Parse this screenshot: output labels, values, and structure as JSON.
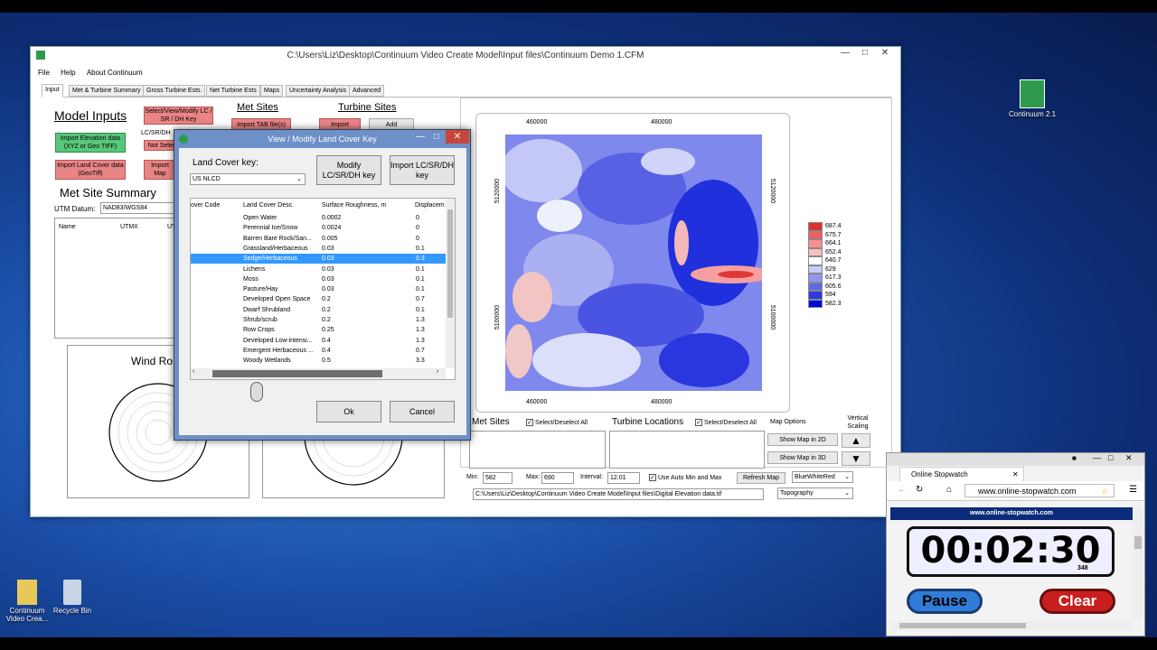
{
  "desktop": {
    "icons": [
      {
        "label": "Continuum 2.1"
      },
      {
        "label": "Continuum Video Crea..."
      },
      {
        "label": "Recycle Bin"
      }
    ]
  },
  "window": {
    "title": "C:\\Users\\Liz\\Desktop\\Continuum Video Create Model\\Input files\\Continuum Demo 1.CFM",
    "menu": [
      "File",
      "Help",
      "About Continuum"
    ],
    "tabs": [
      "Input",
      "Met & Turbine Summary",
      "Gross Turbine Ests.",
      "Net Turbine Ests",
      "Maps",
      "Uncertainty Analysis",
      "Advanced"
    ],
    "model_inputs_heading": "Model Inputs",
    "btn_select_lc": "Select/View/Modify LC / SR / DH Key",
    "lc_label": "LC/SR/DH",
    "not_selected": "Not Selec",
    "btn_import_elev": "Import Elevation data (XYZ or Geo TIFF)",
    "btn_import_lc": "Import Land Cover data (GeoTiff)",
    "btn_import_map": "Import Map",
    "met_sites_heading": "Met Sites",
    "btn_import_tab": "Import TAB file(s)",
    "turbine_sites_heading": "Turbine Sites",
    "btn_import": "Import",
    "btn_add": "Add",
    "met_summary_heading": "Met Site Summary",
    "utm_datum_label": "UTM Datum:",
    "utm_datum_value": "NAD83/WGS84",
    "col_name": "Name",
    "col_utmx": "UTMX",
    "col_utmy": "UT",
    "wind_rose_label": "Wind Ro",
    "map": {
      "x_ticks": [
        "460000",
        "480000"
      ],
      "y_ticks": [
        "5120000",
        "5100000"
      ],
      "legend": [
        "687.4",
        "675.7",
        "664.1",
        "652.4",
        "640.7",
        "629",
        "617.3",
        "605.6",
        "594",
        "582.3"
      ],
      "legend_colors": [
        "#e03030",
        "#f06060",
        "#f49090",
        "#f7c0c0",
        "#ffffff",
        "#c8ccf8",
        "#9098f0",
        "#6068e8",
        "#3038e0",
        "#0008d8"
      ]
    },
    "met_sites_label": "Met Sites",
    "select_all_label": "Select/Deselect All",
    "turbine_locations_label": "Turbine Locations",
    "map_options_label": "Map Options",
    "vertical_scaling_label": "Vertical Scaling",
    "btn_show_2d": "Show Map in 2D",
    "btn_show_3d": "Show Map in 3D",
    "min_label": "Min:",
    "min_value": "582",
    "max_label": "Max:",
    "max_value": "690",
    "interval_label": "Interval:",
    "interval_value": "12.01",
    "auto_minmax_label": "Use Auto Min and Max",
    "btn_refresh": "Refresh Map",
    "color_scheme": "BlueWhiteRed",
    "file_path": "C:\\Users\\Liz\\Desktop\\Continuum Video Create Model\\Input files\\Digital Elevation data.tif",
    "map_type": "Topography"
  },
  "dialog": {
    "title": "View / Modify Land Cover Key",
    "key_label": "Land Cover key:",
    "key_value": "US NLCD",
    "btn_modify": "Modify LC/SR/DH key",
    "btn_import": "Import LC/SR/DH key",
    "columns": [
      "over Code",
      "Land Cover Desc.",
      "Surface Roughness, m",
      "Displacem"
    ],
    "rows": [
      {
        "desc": "Open Water",
        "sr": "0.0002",
        "dh": "0"
      },
      {
        "desc": "Perennial Ice/Snow",
        "sr": "0.0024",
        "dh": "0"
      },
      {
        "desc": "Barren Bare Rock/San...",
        "sr": "0.005",
        "dh": "0"
      },
      {
        "desc": "Grassland/Herbaceous",
        "sr": "0.03",
        "dh": "0.1"
      },
      {
        "desc": "Sedge/Herbaceous",
        "sr": "0.03",
        "dh": "0.3"
      },
      {
        "desc": "Lichens",
        "sr": "0.03",
        "dh": "0.1"
      },
      {
        "desc": "Moss",
        "sr": "0.03",
        "dh": "0.1"
      },
      {
        "desc": "Pasture/Hay",
        "sr": "0.03",
        "dh": "0.1"
      },
      {
        "desc": "Developed Open Space",
        "sr": "0.2",
        "dh": "0.7"
      },
      {
        "desc": "Dwarf Shrubland",
        "sr": "0.2",
        "dh": "0.1"
      },
      {
        "desc": "Shrub/scrub",
        "sr": "0.2",
        "dh": "1.3"
      },
      {
        "desc": "Row Crops",
        "sr": "0.25",
        "dh": "1.3"
      },
      {
        "desc": "Developed Low-intensi...",
        "sr": "0.4",
        "dh": "1.3"
      },
      {
        "desc": "Emergent Herbaceous ...",
        "sr": "0.4",
        "dh": "0.7"
      },
      {
        "desc": "Woody Wetlands",
        "sr": "0.5",
        "dh": "3.3"
      }
    ],
    "btn_ok": "Ok",
    "btn_cancel": "Cancel"
  },
  "stopwatch": {
    "tab_title": "Online Stopwatch",
    "url": "www.online-stopwatch.com",
    "banner": "www.online-stopwatch.com",
    "time": "00:02:30",
    "ms": "348",
    "btn_pause": "Pause",
    "btn_clear": "Clear"
  }
}
